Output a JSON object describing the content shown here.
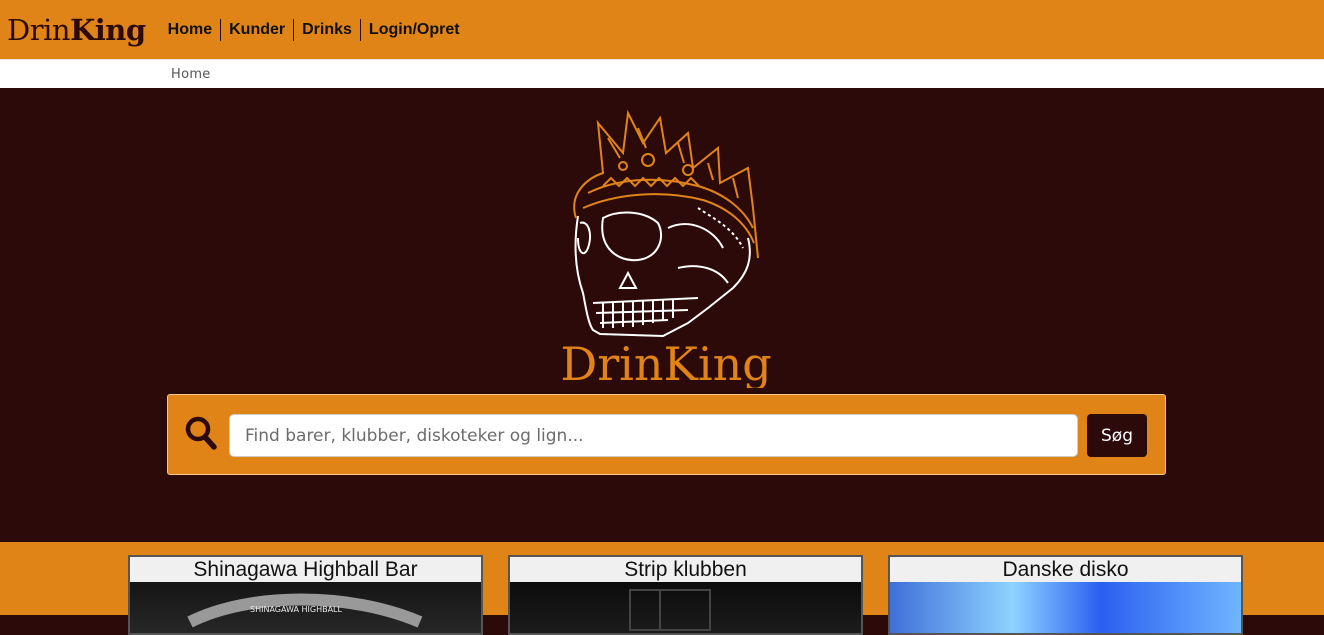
{
  "brand": {
    "name_part1": "Drin",
    "name_part2": "King"
  },
  "nav": {
    "items": [
      {
        "label": "Home"
      },
      {
        "label": "Kunder"
      },
      {
        "label": "Drinks"
      },
      {
        "label": "Login/Opret"
      }
    ]
  },
  "breadcrumb": {
    "current": "Home"
  },
  "hero": {
    "logo_text": "DrinKing",
    "search": {
      "placeholder": "Find barer, klubber, diskoteker og lign...",
      "value": "",
      "button_label": "Søg",
      "icon": "search-icon"
    }
  },
  "cards": [
    {
      "title": "Shinagawa Highball Bar",
      "image_text": "SHINAGAWA HIGHBALL"
    },
    {
      "title": "Strip klubben"
    },
    {
      "title": "Danske disko"
    }
  ],
  "colors": {
    "accent": "#e08418",
    "dark": "#2d0a0a",
    "white": "#ffffff"
  }
}
